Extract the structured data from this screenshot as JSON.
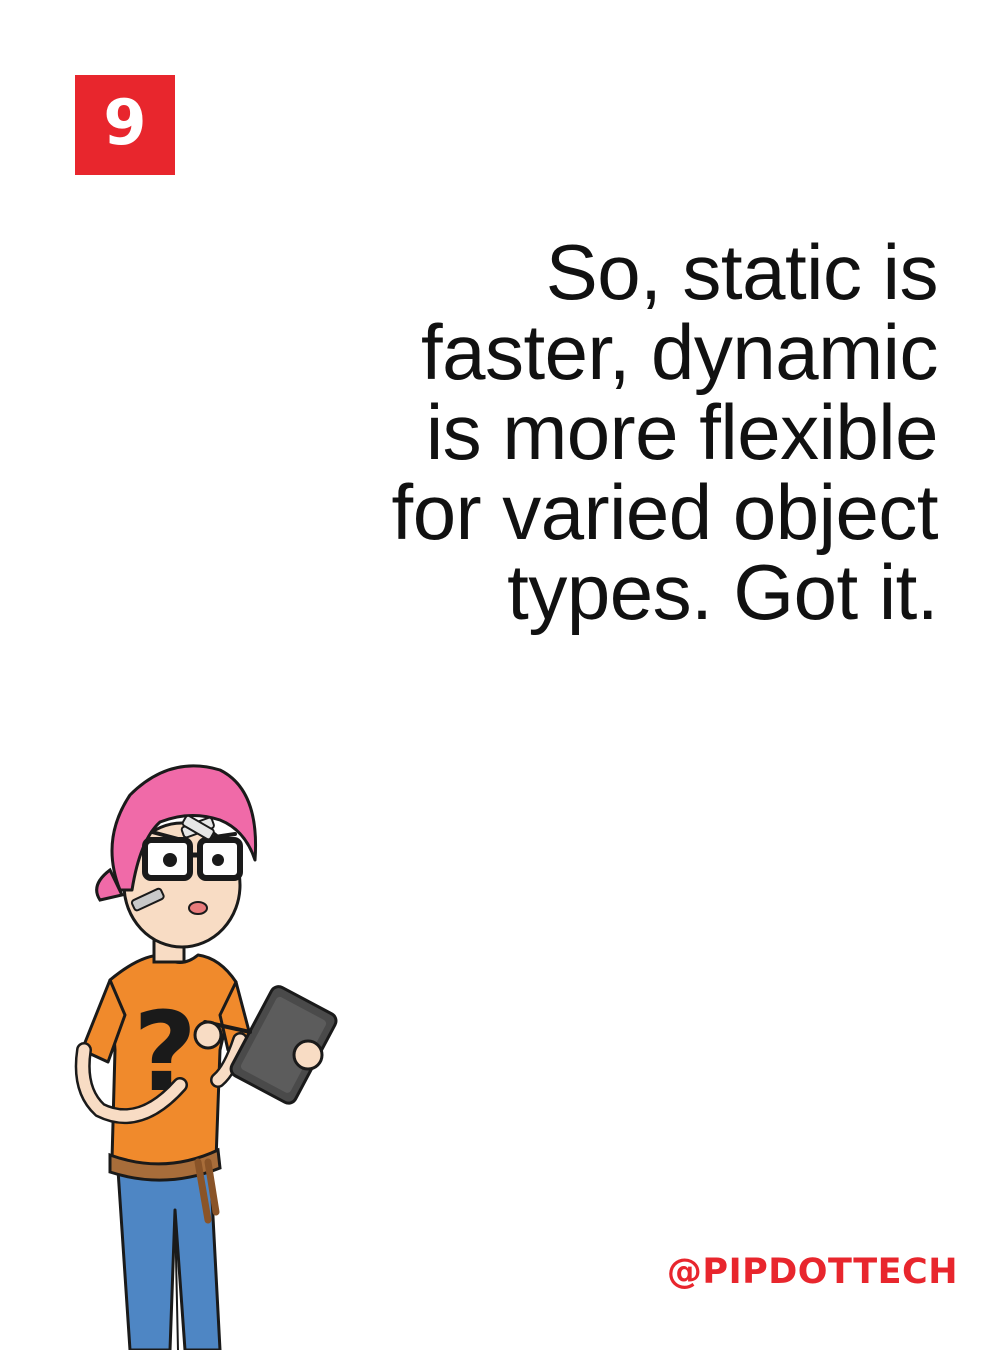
{
  "page_number": "9",
  "quote_lines": [
    "So, static is",
    "faster, dynamic",
    "is more flexible",
    "for varied object",
    "types. Got it."
  ],
  "handle": "@PIPDOTTECH",
  "colors": {
    "accent": "#e8262d",
    "text": "#111111",
    "background": "#ffffff",
    "hair": "#f06aa8",
    "shirt": "#f08a2c",
    "jeans": "#4e86c4",
    "tablet": "#4a4a4a"
  },
  "illustration": {
    "icon": "character-illustration"
  }
}
